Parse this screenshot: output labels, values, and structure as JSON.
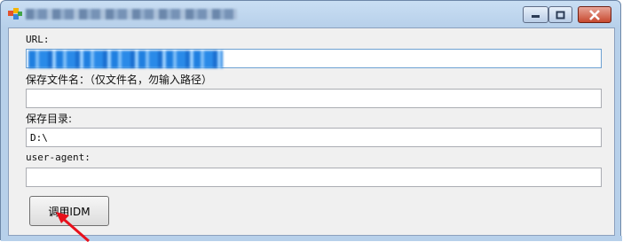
{
  "window": {
    "title": "",
    "controls": {
      "minimize": "minimize-icon",
      "maximize": "maximize-icon",
      "close": "close-icon"
    }
  },
  "form": {
    "url_label": "URL:",
    "url_value": "",
    "filename_label": "保存文件名：（仅文件名，勿输入路径）",
    "filename_value": "",
    "dir_label": "保存目录:",
    "dir_value": "D:\\",
    "ua_label": "user-agent:",
    "ua_value": "",
    "call_button": "调用IDM"
  },
  "colors": {
    "titlebar": "#b7d0ea",
    "client": "#f0f0f0",
    "close_button": "#c7492f",
    "annotation_arrow": "#e8101b"
  }
}
